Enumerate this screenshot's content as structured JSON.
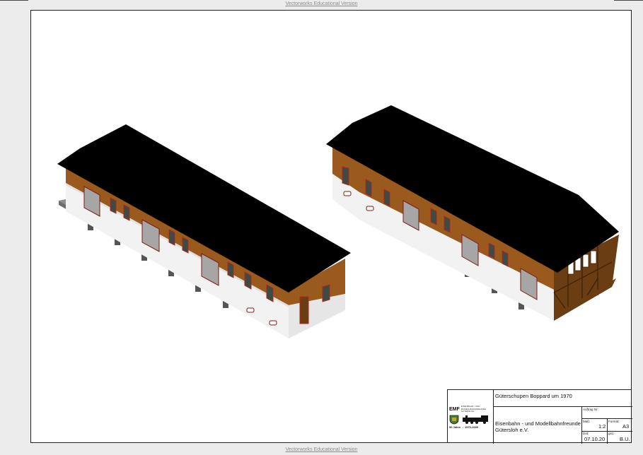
{
  "watermark": {
    "text": "Vectorworks Educational Version"
  },
  "title_block": {
    "title": "Güterschupen Boppard um 1970",
    "organization_line1": "Eisenbahn - und Modellbahnfreunde",
    "organization_line2": "Gütersloh e.V.",
    "auftrag_label": "Auftrag Nr:",
    "auftrag_value": "",
    "massstab_label": "Maß:",
    "massstab_value": "1:2",
    "format_label": "Format:",
    "format_value": "A3",
    "datum_label": "Dat:",
    "datum_value": "07.10.20",
    "gez_label": "gez:",
    "gez_value": "B.U."
  },
  "logo": {
    "abbr": "EMF",
    "name_line1": "EISENBAHN - UND",
    "name_line2": "MODELLBAHNFREUNDE",
    "name_line3": "GÜTERSLOH",
    "anniversary": "50 Jahre  -  1970-2020"
  },
  "colors": {
    "roof": "#000000",
    "brick": "#9a5a1e",
    "brick_dark": "#6b3d12",
    "wall_base": "#f2f2f2",
    "ramp": "#8e8e8e",
    "door": "#a6a6a6",
    "window": "#3e4a44",
    "window_frame": "#b3261e"
  }
}
